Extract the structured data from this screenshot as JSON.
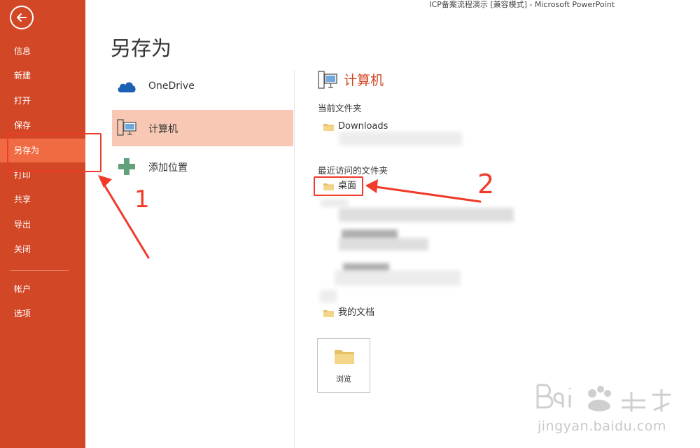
{
  "window": {
    "title": "ICP备案流程演示 [兼容模式] - Microsoft PowerPoint"
  },
  "sidebar": {
    "items": [
      {
        "label": "信息",
        "active": false
      },
      {
        "label": "新建",
        "active": false
      },
      {
        "label": "打开",
        "active": false
      },
      {
        "label": "保存",
        "active": false
      },
      {
        "label": "另存为",
        "active": true
      },
      {
        "label": "打印",
        "active": false
      },
      {
        "label": "共享",
        "active": false
      },
      {
        "label": "导出",
        "active": false
      },
      {
        "label": "关闭",
        "active": false
      }
    ],
    "bottom_items": [
      {
        "label": "帐户"
      },
      {
        "label": "选项"
      }
    ]
  },
  "page": {
    "heading": "另存为"
  },
  "locations": [
    {
      "label": "OneDrive",
      "icon": "cloud-icon"
    },
    {
      "label": "计算机",
      "icon": "computer-icon",
      "selected": true
    },
    {
      "label": "添加位置",
      "icon": "plus-icon"
    }
  ],
  "right_panel": {
    "heading": "计算机",
    "current_folder_title": "当前文件夹",
    "current_folder": {
      "name": "Downloads"
    },
    "recent_title": "最近访问的文件夹",
    "recent_folders": [
      {
        "name": "桌面",
        "highlighted": true
      },
      {
        "name": "我的文档"
      }
    ],
    "browse_label": "浏览"
  },
  "annotations": {
    "arrow1_label": "1",
    "arrow2_label": "2"
  },
  "watermark": {
    "url": "jingyan.baidu.com"
  },
  "colors": {
    "accent": "#d24726",
    "sidebar_active": "#f06a44",
    "selected_bg": "#f8c8b4",
    "annotation": "#f03a2a"
  }
}
